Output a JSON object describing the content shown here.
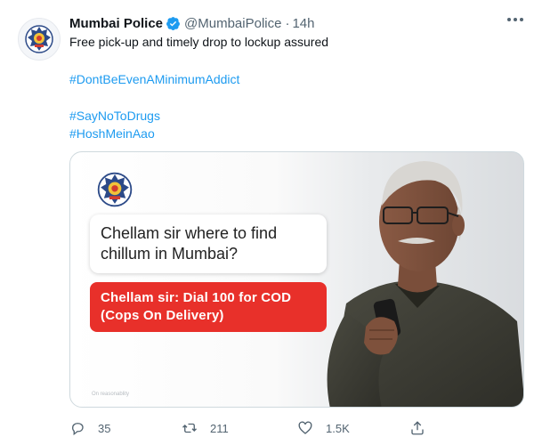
{
  "tweet": {
    "author_name": "Mumbai Police",
    "handle": "@MumbaiPolice",
    "separator": "·",
    "time": "14h",
    "text": "Free pick-up and timely drop to lockup assured",
    "hashtags": [
      "#DontBeEvenAMinimumAddict",
      "#SayNoToDrugs",
      "#HoshMeinAao"
    ]
  },
  "media": {
    "question": "Chellam sir where to find chillum in Mumbai?",
    "answer": "Chellam sir: Dial 100 for COD (Cops On Delivery)",
    "small_caption": "On reasonablity"
  },
  "actions": {
    "replies": "35",
    "retweets": "211",
    "likes": "1.5K"
  },
  "colors": {
    "link": "#1d9bf0",
    "verified": "#1d9bf0",
    "reply_bubble": "#e8302a",
    "muted": "#536471"
  },
  "icons": {
    "verified": "verified-badge-icon",
    "more": "more-dots-icon",
    "reply": "reply-icon",
    "retweet": "retweet-icon",
    "like": "heart-icon",
    "share": "share-icon"
  }
}
